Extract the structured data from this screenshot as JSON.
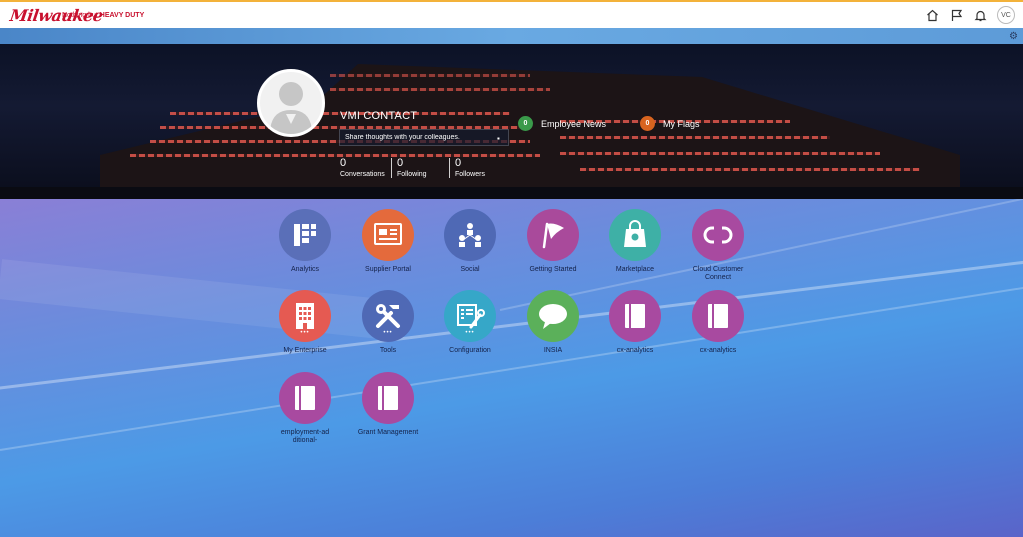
{
  "header": {
    "logo_text": "Milwaukee",
    "tagline_prefix": "Nothing but",
    "tagline_bold": "HEAVY DUTY",
    "icons": [
      "home-icon",
      "flag-icon",
      "bell-icon"
    ],
    "user_initials": "VC",
    "accent_color": "#c8102e"
  },
  "profile": {
    "name": "VMI CONTACT",
    "share_placeholder": "Share thoughts with your colleagues.",
    "stats": [
      {
        "value": "0",
        "label": "Conversations"
      },
      {
        "value": "0",
        "label": "Following"
      },
      {
        "value": "0",
        "label": "Followers"
      }
    ]
  },
  "badges": {
    "news": {
      "count": "0",
      "label": "Employee News",
      "color": "#3a9a4a"
    },
    "flags": {
      "count": "0",
      "label": "My Flags",
      "color": "#d8641f"
    }
  },
  "apps": [
    {
      "label": "Analytics",
      "icon": "analytics-icon",
      "color": "#5a6fb8"
    },
    {
      "label": "Supplier Portal",
      "icon": "supplier-portal-icon",
      "color": "#e46a3c"
    },
    {
      "label": "Social",
      "icon": "social-icon",
      "color": "#4f69b5"
    },
    {
      "label": "Getting Started",
      "icon": "flag-icon",
      "color": "#a94a9b"
    },
    {
      "label": "Marketplace",
      "icon": "bag-icon",
      "color": "#3eb0a6"
    },
    {
      "label": "Cloud Customer Connect",
      "icon": "link-icon",
      "color": "#a84aa0"
    },
    {
      "label": "My Enterprise",
      "icon": "building-icon",
      "color": "#e55a52"
    },
    {
      "label": "Tools",
      "icon": "tools-icon",
      "color": "#4f69b5"
    },
    {
      "label": "Configuration",
      "icon": "configuration-icon",
      "color": "#36a7c8"
    },
    {
      "label": "INSIA",
      "icon": "chat-icon",
      "color": "#5bb05a"
    },
    {
      "label": "cx-analytics",
      "icon": "book-icon",
      "color": "#a84aa0"
    },
    {
      "label": "cx-analytics",
      "icon": "book-icon",
      "color": "#a84aa0"
    },
    {
      "label": "employment-additional-",
      "icon": "book-icon",
      "color": "#a84aa0"
    },
    {
      "label": "Grant Management",
      "icon": "book-icon",
      "color": "#a84aa0"
    }
  ]
}
